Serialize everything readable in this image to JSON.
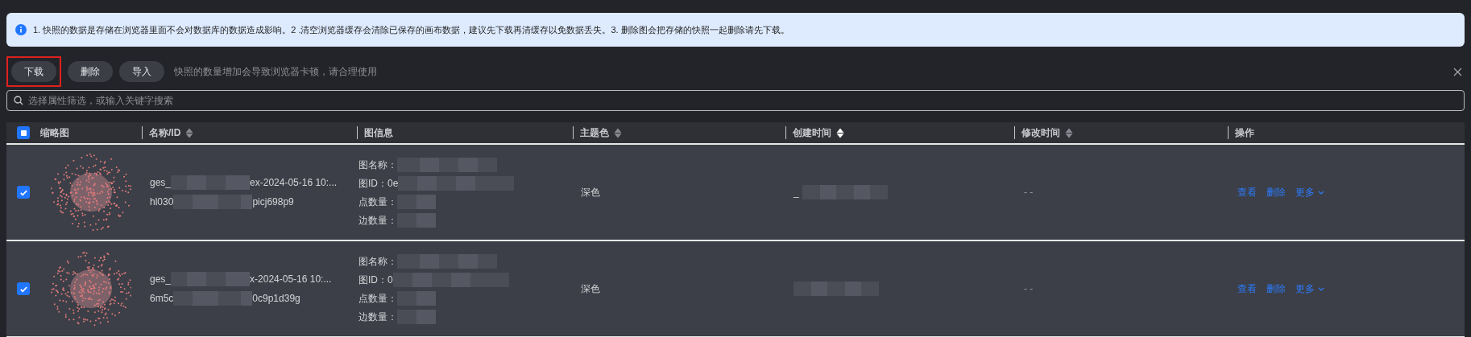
{
  "alert": {
    "text": "1. 快照的数据是存储在浏览器里面不会对数据库的数据造成影响。2 .清空浏览器缓存会清除已保存的画布数据，建议先下载再清缓存以免数据丢失。3. 删除图会把存储的快照一起删除请先下载。"
  },
  "toolbar": {
    "buttons": [
      {
        "label": "下载",
        "highlighted": true
      },
      {
        "label": "删除",
        "highlighted": false
      },
      {
        "label": "导入",
        "highlighted": false
      }
    ],
    "hint": "快照的数量增加会导致浏览器卡顿，请合理使用"
  },
  "search": {
    "placeholder": "选择属性筛选，或输入关键字搜索"
  },
  "table": {
    "select_all": {
      "indeterminate": true
    },
    "columns": [
      {
        "label": "缩略图",
        "sortable": false
      },
      {
        "label": "名称/ID",
        "sortable": true,
        "sorted": false
      },
      {
        "label": "图信息",
        "sortable": false
      },
      {
        "label": "主题色",
        "sortable": true,
        "sorted": false
      },
      {
        "label": "创建时间",
        "sortable": true,
        "sorted": true
      },
      {
        "label": "修改时间",
        "sortable": true,
        "sorted": false
      },
      {
        "label": "操作",
        "sortable": false
      }
    ],
    "rows": [
      {
        "checked": true,
        "name_parts": [
          "ges_",
          "ex-2024-05-16 10:..."
        ],
        "id_parts": [
          "hl030",
          "picj698p9"
        ],
        "info": [
          "图名称：",
          "图ID：0e",
          "点数量：",
          "边数量："
        ],
        "theme": "深色",
        "created": "_",
        "modified": "- -",
        "actions": [
          {
            "label": "查看",
            "kind": "link"
          },
          {
            "label": "删除",
            "kind": "link"
          },
          {
            "label": "更多",
            "kind": "dropdown"
          }
        ]
      },
      {
        "checked": true,
        "name_parts": [
          "ges_",
          "x-2024-05-16 10:..."
        ],
        "id_parts": [
          "6m5c",
          "0c9p1d39g"
        ],
        "info": [
          "图名称：",
          "图ID：0",
          "点数量：",
          "边数量："
        ],
        "theme": "深色",
        "modified": "- -",
        "actions": [
          {
            "label": "查看",
            "kind": "link"
          },
          {
            "label": "删除",
            "kind": "link"
          },
          {
            "label": "更多",
            "kind": "dropdown"
          }
        ]
      }
    ]
  }
}
